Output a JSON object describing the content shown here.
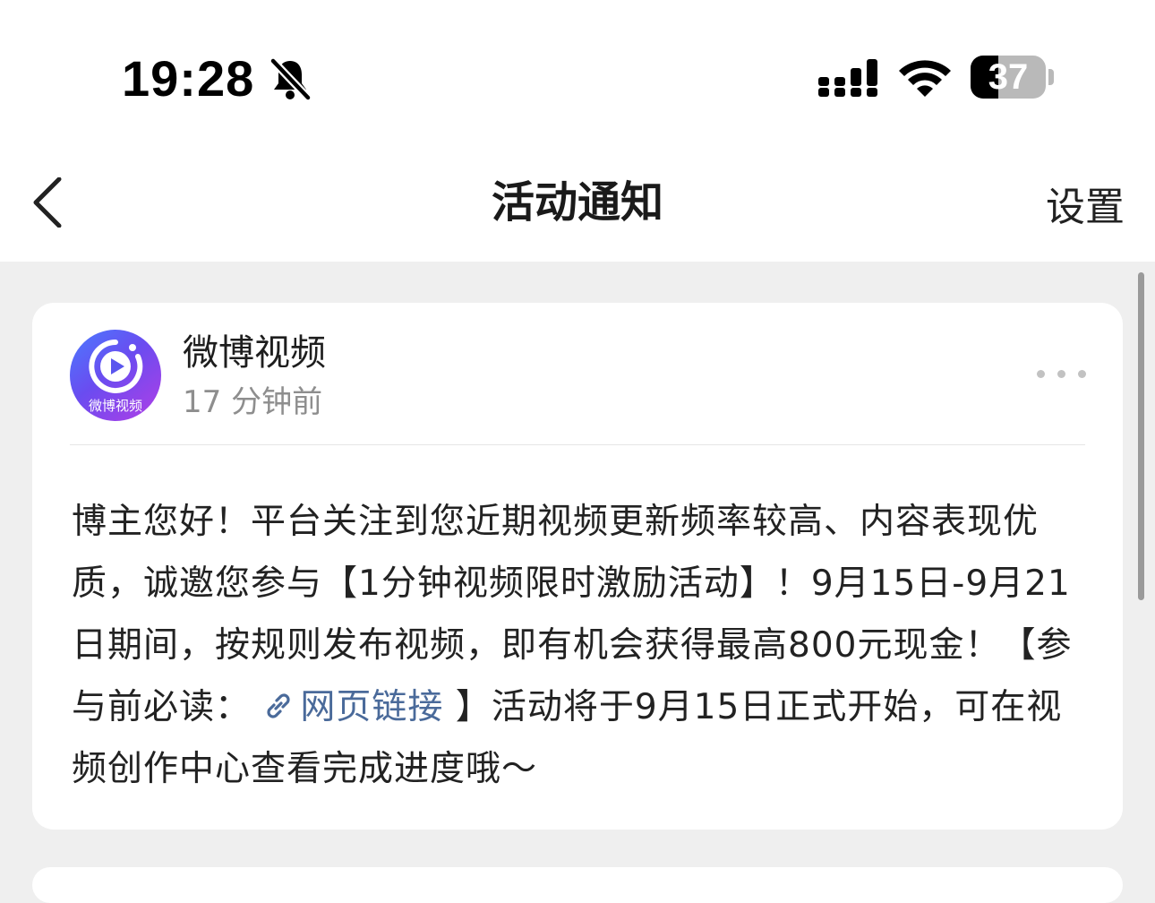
{
  "status_bar": {
    "time": "19:28",
    "battery_level": 37,
    "battery_text": "37",
    "icons": [
      "bell-slash-icon",
      "cellular-signal-icon",
      "wifi-icon",
      "battery-icon"
    ]
  },
  "nav": {
    "back_icon": "chevron-left-icon",
    "title": "活动通知",
    "settings_label": "设置"
  },
  "notification": {
    "avatar_caption": "微博视频",
    "avatar_icon": "play-icon",
    "sender": "微博视频",
    "time": "17 分钟前",
    "more_icon": "more-dots-icon",
    "body_part1": "博主您好！平台关注到您近期视频更新频率较高、内容表现优质，诚邀您参与【1分钟视频限时激励活动】！9月15日-9月21日期间，按规则发布视频，即有机会获得最高800元现金！【参与前必读：",
    "link_icon": "link-icon",
    "link_label": "网页链接",
    "body_part2": "】活动将于9月15日正式开始，可在视频创作中心查看完成进度哦～"
  },
  "colors": {
    "background": "#efefef",
    "card": "#ffffff",
    "link": "#4a6a9a",
    "muted_text": "#8e8e8e"
  }
}
